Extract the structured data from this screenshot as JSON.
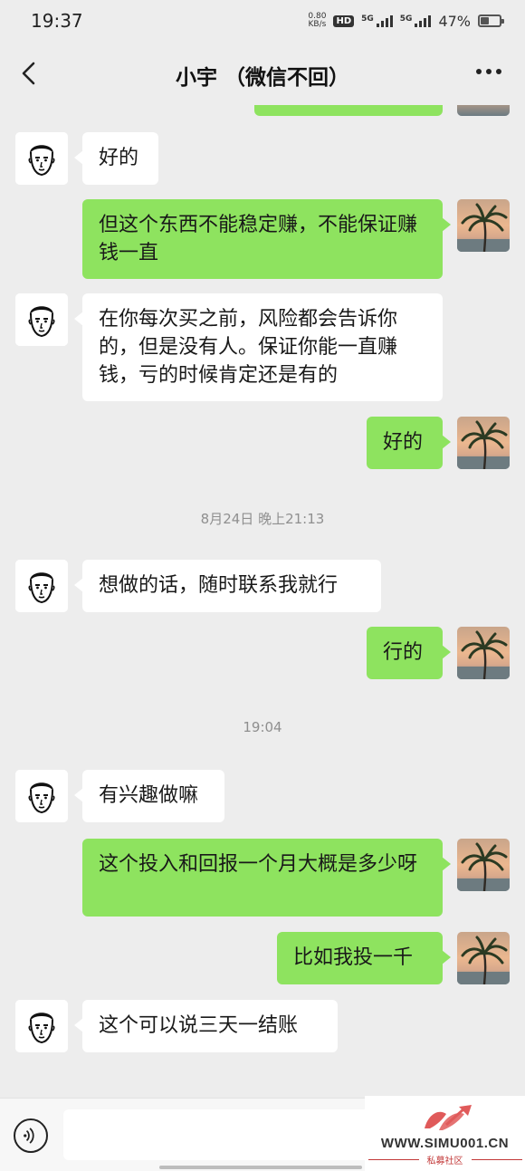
{
  "status_bar": {
    "time": "19:37",
    "net_speed_value": "0.80",
    "net_speed_unit": "KB/s",
    "hd_label": "HD",
    "sim1_label": "5G",
    "sim2_label": "5G",
    "battery_percent_label": "47%",
    "battery_level": 0.47
  },
  "header": {
    "title": "小宇 （微信不回）"
  },
  "messages": [
    {
      "side": "left",
      "text": "好的"
    },
    {
      "side": "right",
      "text": "但这个东西不能稳定赚，不能保证赚钱一直"
    },
    {
      "side": "left",
      "text": "在你每次买之前，风险都会告诉你的，但是没有人。保证你能一直赚钱，亏的时候肯定还是有的"
    },
    {
      "side": "right",
      "text": "好的"
    },
    {
      "side": "time",
      "text": "8月24日 晚上21:13"
    },
    {
      "side": "left",
      "text": "想做的话，随时联系我就行"
    },
    {
      "side": "right",
      "text": "行的"
    },
    {
      "side": "time",
      "text": "19:04"
    },
    {
      "side": "left",
      "text": "有兴趣做嘛"
    },
    {
      "side": "right",
      "text": "这个投入和回报一个月大概是多少呀"
    },
    {
      "side": "right",
      "text": "比如我投一千"
    },
    {
      "side": "left",
      "text": "这个可以说三天一结账"
    }
  ],
  "input": {
    "value": "",
    "voice_icon": "voice-icon"
  },
  "watermark": {
    "url": "WWW.SIMU001.CN",
    "caption": "私募社区"
  },
  "colors": {
    "background": "#ededed",
    "bubble_self": "#8ee35f",
    "bubble_other": "#ffffff"
  }
}
